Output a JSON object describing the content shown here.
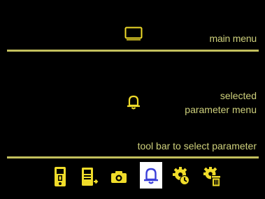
{
  "main_menu": {
    "label": "main menu",
    "icon": "monitor-icon"
  },
  "parameter_menu": {
    "label_line1": "selected",
    "label_line2": "parameter menu",
    "icon": "bell-icon"
  },
  "toolbar": {
    "label": "tool bar to select parameter",
    "items": [
      {
        "icon": "device-icon",
        "selected": false
      },
      {
        "icon": "export-icon",
        "selected": false
      },
      {
        "icon": "camera-icon",
        "selected": false
      },
      {
        "icon": "bell-icon",
        "selected": true
      },
      {
        "icon": "gear-clock-icon",
        "selected": false
      },
      {
        "icon": "gear-trash-icon",
        "selected": false
      }
    ]
  },
  "colors": {
    "background": "#000000",
    "accent": "#f0dc2a",
    "text": "#cfd17c",
    "divider": "#c3c05d",
    "selected_bg": "#ffffff",
    "selected_icon": "#3b3fd9"
  }
}
